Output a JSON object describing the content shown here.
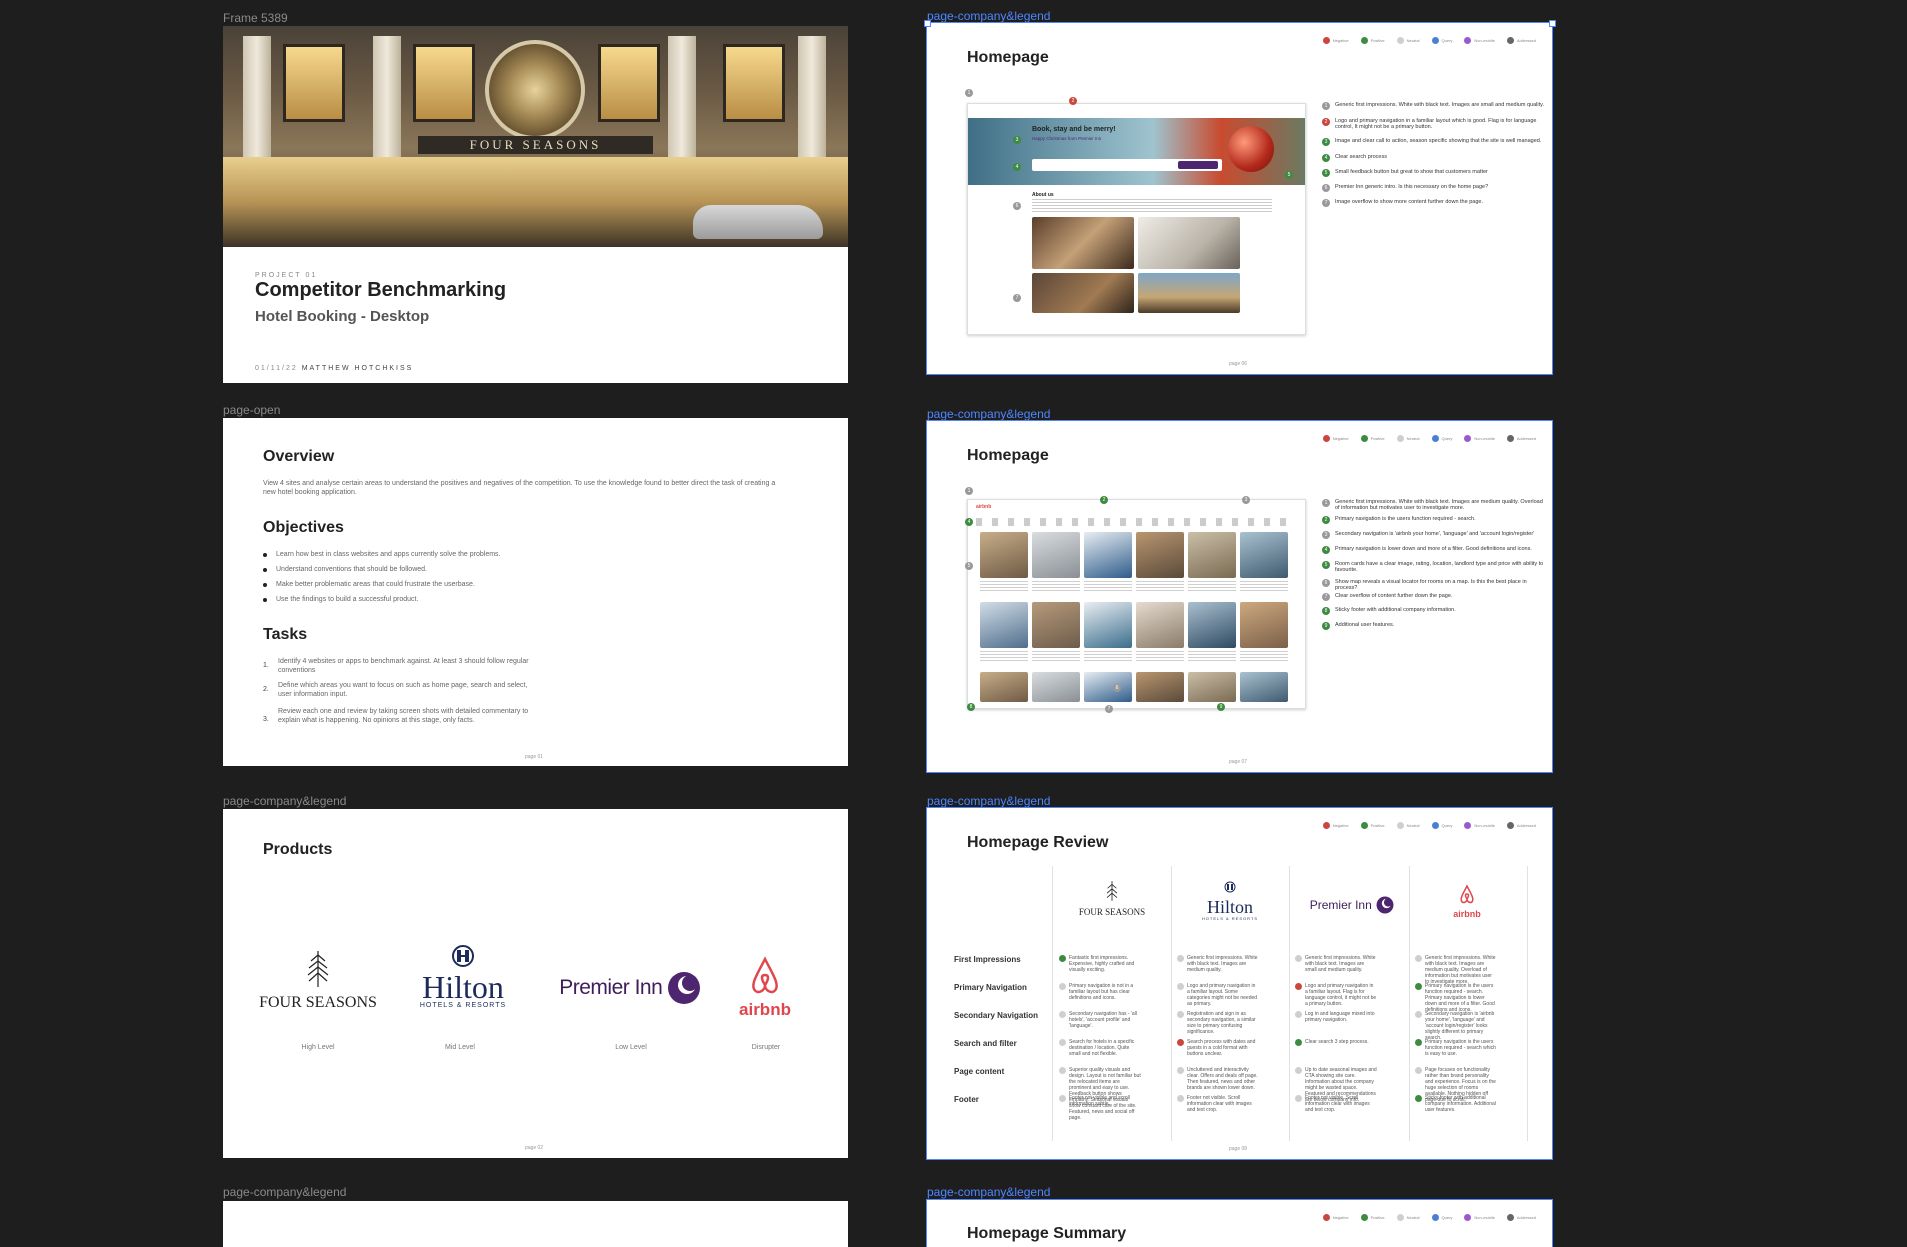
{
  "frames": {
    "cover": {
      "label": "Frame 5389",
      "sign": "FOUR SEASONS",
      "project": "PROJECT 01",
      "title": "Competitor Benchmarking",
      "subtitle": "Hotel Booking - Desktop",
      "date": "01/11/22",
      "author": "MATTHEW HOTCHKISS"
    },
    "open": {
      "label": "page-open",
      "overview_title": "Overview",
      "overview_text": "View 4 sites and analyse certain areas to understand the positives and negatives of the competition.  To use the knowledge found to better direct the task of creating a new hotel booking application.",
      "objectives_title": "Objectives",
      "objectives": [
        "Learn how best in class websites and apps currently solve the problems.",
        "Understand conventions that should be followed.",
        "Make better problematic areas that could frustrate the userbase.",
        "Use the findings to build a successful product."
      ],
      "tasks_title": "Tasks",
      "tasks": [
        {
          "n": "1.",
          "text": "Identify 4 websites or apps to benchmark against.  At least 3 should follow regular conventions"
        },
        {
          "n": "2.",
          "text": "Define which areas you want to focus on such as home page, search and select, user information input."
        },
        {
          "n": "3.",
          "text": "Review each one and review by taking screen shots with detailed commentary to explain what is happening.  No opinions at this stage, only facts."
        }
      ],
      "page": "page 01"
    },
    "products": {
      "label": "page-company&legend",
      "title": "Products",
      "items": [
        {
          "logo": "FOUR SEASONS",
          "level": "High Level"
        },
        {
          "logo": "Hilton",
          "logo_sub": "HOTELS & RESORTS",
          "level": "Mid Level"
        },
        {
          "logo": "Premier Inn",
          "level": "Low Level"
        },
        {
          "logo": "airbnb",
          "level": "Disrupter"
        }
      ],
      "page": "page 02"
    },
    "bottom_left": {
      "label": "page-company&legend"
    },
    "home1": {
      "label": "page-company&legend",
      "title": "Homepage",
      "hero_text": "Book, stay and be merry!",
      "hero_sub": "Happy Christmas from Premier Inn",
      "about": "About us",
      "notes": [
        "Generic first impressions.  White with black text.  Images are small and medium quality.",
        "Logo and primary navigation in a familiar layout which is good.  Flag is for language control, It might not be a primary button.",
        "Image and clear call to action, season specific showing that the site is well managed.",
        "Clear search process",
        "Small feedback button but great to show that customers matter",
        "Premier Inn generic intro.  Is this necessary on the home page?",
        "Image overflow to show more content further down the page."
      ],
      "page": "page 06"
    },
    "home2": {
      "label": "page-company&legend",
      "title": "Homepage",
      "brand": "airbnb",
      "notes": [
        "Generic first impressions.  White with black text.  Images are medium quality.  Overload of information but motivates user to investigate more.",
        "Primary navigation is the users function required - search.",
        "Secondary navigation is 'airbnb your home', 'language' and 'account login/register'",
        "Primary navigation is lower down and more of a filter.  Good definitions and icons.",
        "Room cards have a clear image, rating, location, landlord type and price with ability to favourite.",
        "Show map reveals a visual locator for rooms on a map. Is this the best place in process?",
        "Clear overflow of content further down the page.",
        "Sticky footer with additional company information.",
        "Additional user features."
      ],
      "page": "page 07"
    },
    "review": {
      "label": "page-company&legend",
      "title": "Homepage Review",
      "rows": [
        "First Impressions",
        "Primary Navigation",
        "Secondary Navigation",
        "Search and filter",
        "Page content",
        "Footer"
      ],
      "cols": [
        {
          "brand": "FOUR SEASONS",
          "cells": [
            {
              "c": "#3d8b40",
              "t": "Fantastic first impressions. Expensive, highly crafted and visually exciting."
            },
            {
              "c": "#cfcfcf",
              "t": "Primary navigation is not in a familiar layout but has clear definitions and icons."
            },
            {
              "c": "#cfcfcf",
              "t": "Secondary navigation has - 'all hotels', 'account profile' and 'language'."
            },
            {
              "c": "#cfcfcf",
              "t": "Search for hotels in a specific destination / location. Quite small and not flexible."
            },
            {
              "c": "#cfcfcf",
              "t": "Superior quality visuals and design. Layout is not familiar but the relocated items are prominent and easy to use. Feedback button shows empathy. Seasonal visuals show constant care of the site. Featured, news and social off page."
            },
            {
              "c": "#cfcfcf",
              "t": "Footer not visible and scroll information subtle."
            }
          ]
        },
        {
          "brand": "Hilton",
          "cells": [
            {
              "c": "#cfcfcf",
              "t": "Generic first impressions.  White with black text.  Images are medium quality."
            },
            {
              "c": "#cfcfcf",
              "t": "Logo and primary navigation in a familiar layout. Some categories might not be needed as primary."
            },
            {
              "c": "#cfcfcf",
              "t": "Registration and sign in as secondary navigation, a similar size to primary confusing significance."
            },
            {
              "c": "#c9473d",
              "t": "Search process with dates and guests in a cold format with buttons unclear."
            },
            {
              "c": "#cfcfcf",
              "t": "Uncluttered and interactivity clear. Offers and deals off page. Then featured, news and other brands are shown lower down."
            },
            {
              "c": "#cfcfcf",
              "t": "Footer not visible. Scroll information clear with images and text crop."
            }
          ]
        },
        {
          "brand": "Premier Inn",
          "cells": [
            {
              "c": "#cfcfcf",
              "t": "Generic first impressions.  White with black text.  Images are small and medium quality."
            },
            {
              "c": "#c9473d",
              "t": "Logo and primary navigation in a familiar layout. Flag is for language control, it might not be a primary button."
            },
            {
              "c": "#cfcfcf",
              "t": "Log in and language mixed into primary navigation."
            },
            {
              "c": "#3d8b40",
              "t": "Clear search 3 step process."
            },
            {
              "c": "#cfcfcf",
              "t": "Up to date seasonal images and CTA showing site care.  Information about the company might be wasted space. Featured and recommendations are below company info."
            },
            {
              "c": "#cfcfcf",
              "t": "Footer not visible.  Scroll information clear with images and text crop."
            }
          ]
        },
        {
          "brand": "airbnb",
          "cells": [
            {
              "c": "#cfcfcf",
              "t": "Generic first impressions.  White with black text.  Images are medium quality. Overload of information but motivates user to investigate more."
            },
            {
              "c": "#3d8b40",
              "t": "Primary navigation is the users function required - search. Primary navigation is lower down and more of a filter. Good definitions and icons."
            },
            {
              "c": "#cfcfcf",
              "t": "Secondary navigation is 'airbnb your home', 'language' and 'account login/register' looks slightly different to primary search."
            },
            {
              "c": "#3d8b40",
              "t": "Primary navigation is the users function required - search which is easy to use."
            },
            {
              "c": "#cfcfcf",
              "t": "Page focuses on functionality rather than brand personality and experience.  Focus is on the huge selection of rooms available. Nothing hidden off page due to scroll."
            },
            {
              "c": "#3d8b40",
              "t": "Sticky footer with additional company information.  Additional user features."
            }
          ]
        }
      ],
      "page": "page 08"
    },
    "summary": {
      "label": "page-company&legend",
      "title": "Homepage Summary"
    }
  },
  "legend": [
    {
      "label": "Negative",
      "color": "#c9473d"
    },
    {
      "label": "Positive",
      "color": "#3d8b40"
    },
    {
      "label": "Neutral",
      "color": "#cfcfcf"
    },
    {
      "label": "Query",
      "color": "#4a7fd4"
    },
    {
      "label": "Non-mobile",
      "color": "#9b59d0"
    },
    {
      "label": "Addressed",
      "color": "#666666"
    }
  ]
}
